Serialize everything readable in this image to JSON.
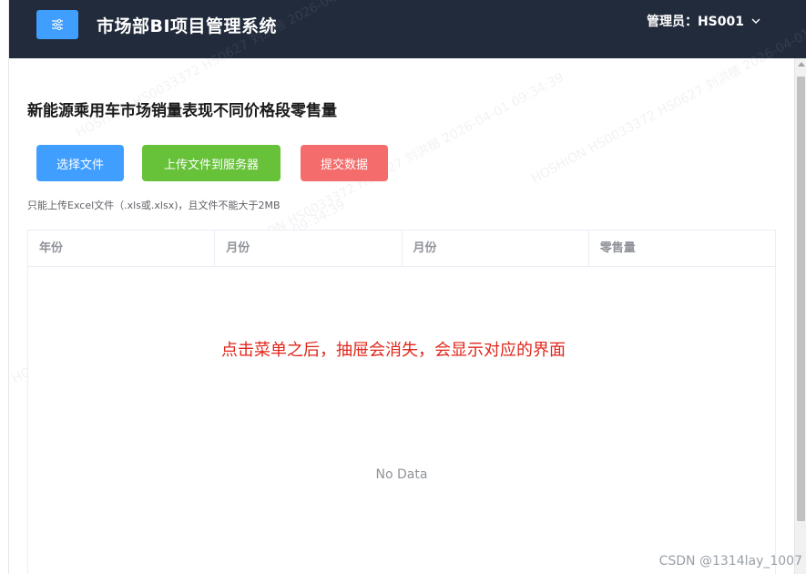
{
  "header": {
    "app_title": "市场部BI项目管理系统",
    "user_label": "管理员：HS001",
    "menu_icon": "sliders-icon"
  },
  "page": {
    "title": "新能源乘用车市场销量表现不同价格段零售量",
    "buttons": {
      "select_file": "选择文件",
      "upload_file": "上传文件到服务器",
      "submit_data": "提交数据"
    },
    "upload_tip": "只能上传Excel文件（.xls或.xlsx)，且文件不能大于2MB"
  },
  "table": {
    "columns": [
      "年份",
      "月份",
      "月份",
      "零售量"
    ],
    "empty_text": "No Data"
  },
  "annotation": "点击菜单之后，抽屉会消失，会显示对应的界面",
  "watermark": {
    "text": "HOSHION HS0033372 HS0627 刘洪楷 2026-04-01 09:34:39"
  },
  "footer": {
    "csdn_credit": "CSDN @1314lay_1007"
  },
  "colors": {
    "header_bg": "#222b3c",
    "primary": "#409eff",
    "success": "#67c23a",
    "danger": "#f56c6c",
    "annotation": "#e0261b"
  }
}
